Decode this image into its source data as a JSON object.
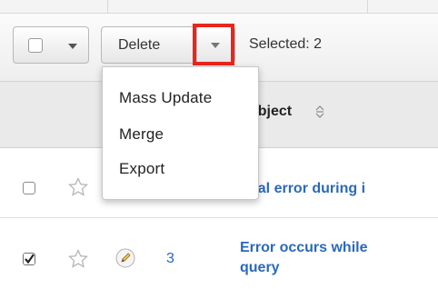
{
  "toolbar": {
    "delete_label": "Delete",
    "selected_text": "Selected: 2"
  },
  "actions_menu": {
    "items": [
      {
        "label": "Mass Update"
      },
      {
        "label": "Merge"
      },
      {
        "label": "Export"
      }
    ]
  },
  "table": {
    "subject_header": "ubject",
    "rows": [
      {
        "checked": false,
        "favorite": false,
        "number": "",
        "subject": "ital error during i"
      },
      {
        "checked": true,
        "favorite": false,
        "number": "3",
        "subject_line1": "Error occurs while",
        "subject_line2": "query"
      }
    ]
  },
  "colors": {
    "highlight": "#e8261c",
    "link": "#2a68c0"
  },
  "icons": [
    "caret-down-icon",
    "sort-icon",
    "star-icon",
    "pencil-icon",
    "checkbox-icon"
  ]
}
